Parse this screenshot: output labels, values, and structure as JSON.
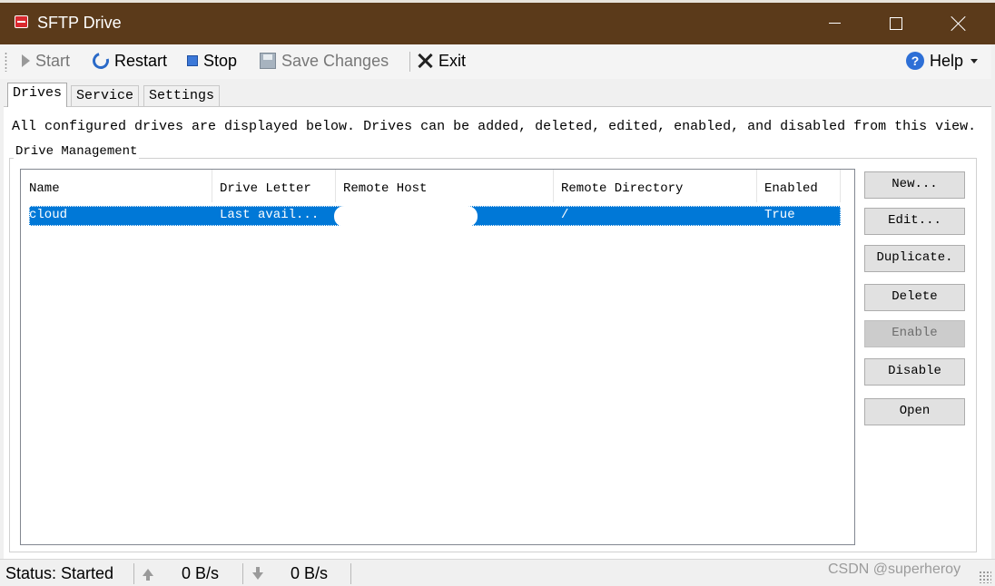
{
  "window": {
    "title": "SFTP Drive"
  },
  "toolbar": {
    "start": "Start",
    "restart": "Restart",
    "stop": "Stop",
    "save_changes": "Save Changes",
    "exit": "Exit",
    "help": "Help",
    "help_icon_glyph": "?"
  },
  "tabs": [
    {
      "label": "Drives",
      "active": true
    },
    {
      "label": "Service",
      "active": false
    },
    {
      "label": "Settings",
      "active": false
    }
  ],
  "drives_tab": {
    "description": "All configured drives are displayed below. Drives can be added, deleted, edited, enabled, and disabled from this view.",
    "group_title": "Drive Management",
    "columns": [
      "Name",
      "Drive Letter",
      "Remote Host",
      "Remote Directory",
      "Enabled"
    ],
    "rows": [
      {
        "name": "cloud",
        "drive_letter": "Last avail...",
        "remote_host": "",
        "remote_directory": "/",
        "enabled": "True",
        "selected": true
      }
    ],
    "buttons": [
      {
        "label": "New...",
        "enabled": true
      },
      {
        "label": "Edit...",
        "enabled": true
      },
      {
        "label": "Duplicate.",
        "enabled": true
      },
      {
        "label": "Delete",
        "enabled": true
      },
      {
        "label": "Enable",
        "enabled": false
      },
      {
        "label": "Disable",
        "enabled": true
      },
      {
        "label": "Open",
        "enabled": true
      }
    ]
  },
  "status": {
    "text": "Status: Started",
    "upload_rate": "0 B/s",
    "download_rate": "0 B/s"
  },
  "watermark": "CSDN @superheroy",
  "colors": {
    "titlebar": "#5b3a1a",
    "selection": "#0078d7"
  }
}
